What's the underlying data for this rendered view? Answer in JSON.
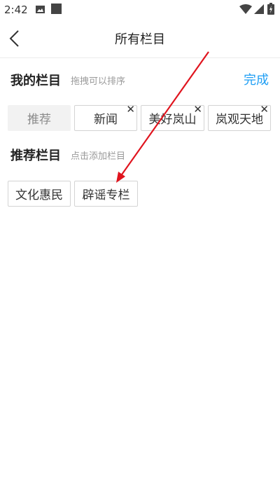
{
  "status_bar": {
    "time": "2:42"
  },
  "header": {
    "title": "所有栏目"
  },
  "my_channels": {
    "title": "我的栏目",
    "hint": "拖拽可以排序",
    "done_label": "完成",
    "items": [
      {
        "label": "推荐"
      },
      {
        "label": "新闻"
      },
      {
        "label": "美好岚山"
      },
      {
        "label": "岚观天地"
      }
    ]
  },
  "recommended_channels": {
    "title": "推荐栏目",
    "hint": "点击添加栏目",
    "items": [
      {
        "label": "文化惠民"
      },
      {
        "label": "辟谣专栏"
      }
    ]
  },
  "colors": {
    "accent": "#1e9ef4",
    "annotation": "#e0141e"
  }
}
